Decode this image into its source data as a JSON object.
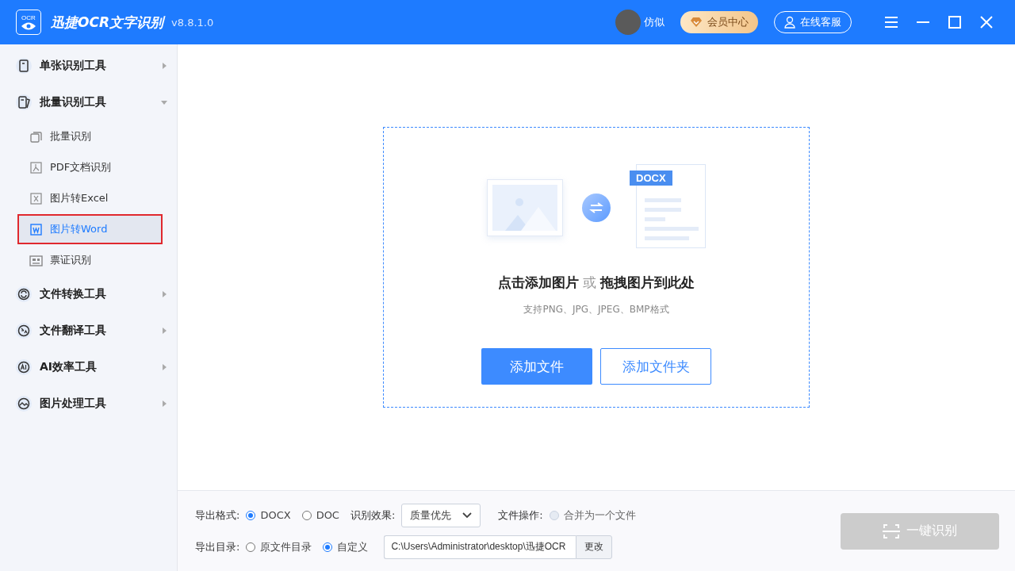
{
  "window": {
    "logo_text": "OCR",
    "title": "迅捷OCR文字识别",
    "version": "v8.8.1.0"
  },
  "header": {
    "user_name": "仿似",
    "vip_label": "会员中心",
    "service_label": "在线客服"
  },
  "sidebar": {
    "groups": [
      {
        "label": "单张识别工具",
        "expanded": false
      },
      {
        "label": "批量识别工具",
        "expanded": true,
        "children": [
          {
            "label": "批量识别",
            "selected": false
          },
          {
            "label": "PDF文档识别",
            "selected": false
          },
          {
            "label": "图片转Excel",
            "selected": false
          },
          {
            "label": "图片转Word",
            "selected": true
          },
          {
            "label": "票证识别",
            "selected": false
          }
        ]
      },
      {
        "label": "文件转换工具",
        "expanded": false
      },
      {
        "label": "文件翻译工具",
        "expanded": false
      },
      {
        "label": "AI效率工具",
        "expanded": false
      },
      {
        "label": "图片处理工具",
        "expanded": false
      }
    ]
  },
  "drop_zone": {
    "doc_tag": "DOCX",
    "headline": "**点击添加图片** 或 **拖拽图片到此处**",
    "hint": "支持PNG、JPG、JPEG、BMP格式",
    "buttons": [
      {
        "label": "添加文件",
        "kind": "primary"
      },
      {
        "label": "添加文件夹",
        "kind": "outline"
      }
    ]
  },
  "options": {
    "format_label": "导出格式:",
    "formats": [
      {
        "label": "DOCX",
        "selected": true
      },
      {
        "label": "DOC",
        "selected": false
      }
    ],
    "effect_label": "识别效果:",
    "effect_value": "质量优先",
    "operation_label": "文件操作:",
    "merge": {
      "label": "合并为一个文件",
      "checked": false,
      "disabled": true
    },
    "dir_label": "导出目录:",
    "dirs": [
      {
        "label": "原文件目录",
        "selected": false
      },
      {
        "label": "自定义",
        "selected": true
      }
    ],
    "path_value": "C:\\Users\\Administrator\\desktop\\迅捷OCR",
    "change_label": "更改",
    "run": {
      "label": "一键识别",
      "disabled": true
    }
  }
}
